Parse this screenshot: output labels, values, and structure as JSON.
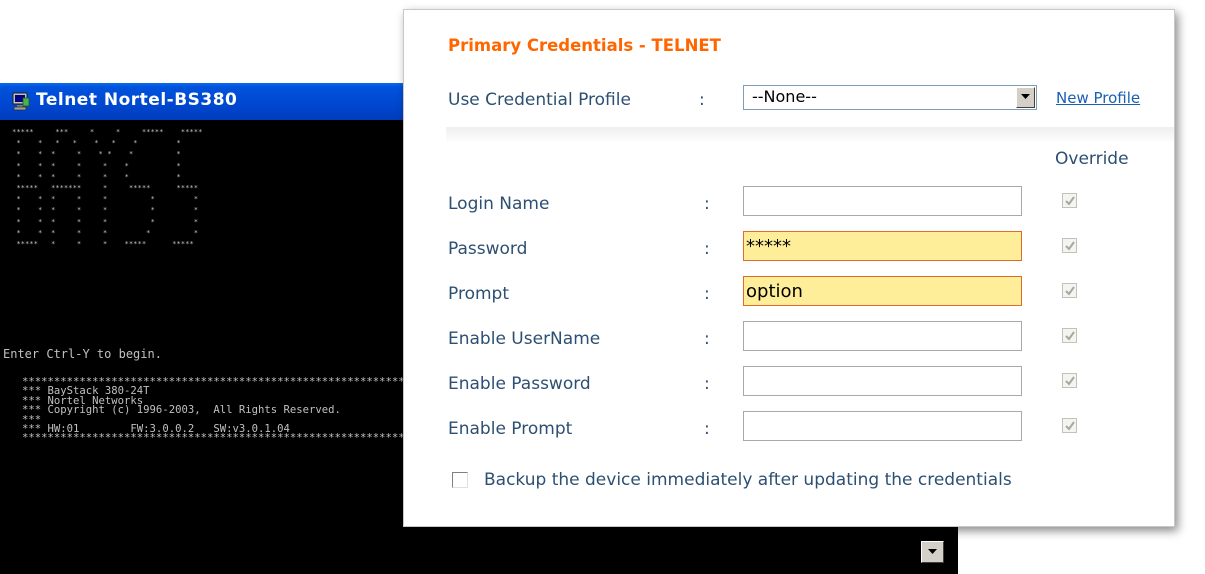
{
  "telnet": {
    "title": "Telnet Nortel-BS380",
    "banner_art": "*****     ***     *     *     *****    *****\n *    *   *   *    *   *    *         *\n *    *  *     *    * *    *          *\n *    *  *     *     *    *           *\n *    *  *     *     *    *           *\n *****   *******     *     *****      *****\n *    *  *     *     *          *         *\n *    *  *     *     *          *         *\n *    *  *     *     *          *         *\n *    *  *     *     *         *          *\n *****   *     *     *    *****      *****",
    "prompt_text": "Enter Ctrl-Y to begin.",
    "info_text": "****************************************************************\n*** BayStack 380-24T\n*** Nortel Networks\n*** Copyright (c) 1996-2003,  All Rights Reserved.\n***\n*** HW:01        FW:3.0.0.2   SW:v3.0.1.04\n****************************************************************"
  },
  "panel": {
    "title": "Primary Credentials - TELNET",
    "profile": {
      "label": "Use Credential Profile",
      "colon": ":",
      "selected": "--None--",
      "new_profile_link": "New Profile"
    },
    "override_header": "Override",
    "fields": [
      {
        "label": "Login Name",
        "colon": ":",
        "value": "",
        "override_checked": true
      },
      {
        "label": "Password",
        "colon": ":",
        "value": "*****",
        "override_checked": true
      },
      {
        "label": "Prompt",
        "colon": ":",
        "value": "option",
        "override_checked": true
      },
      {
        "label": "Enable UserName",
        "colon": ":",
        "value": "",
        "override_checked": true
      },
      {
        "label": "Enable Password",
        "colon": ":",
        "value": "",
        "override_checked": true
      },
      {
        "label": "Enable Prompt",
        "colon": ":",
        "value": "",
        "override_checked": true
      }
    ],
    "backup": {
      "label": "Backup the device immediately after updating the credentials",
      "checked": false
    }
  },
  "colors": {
    "title_orange": "#ff6600",
    "label_blue": "#2c4f72",
    "link_blue": "#1a5fb4",
    "highlight_fill": "#ffee99",
    "highlight_border": "#e06c2a",
    "titlebar_blue": "#0047d0"
  },
  "icons": {
    "telnet_app": "console-window-icon",
    "dropdown": "chevron-down-icon",
    "scroll": "scroll-down-arrow-icon",
    "override": "checkmark-icon"
  }
}
